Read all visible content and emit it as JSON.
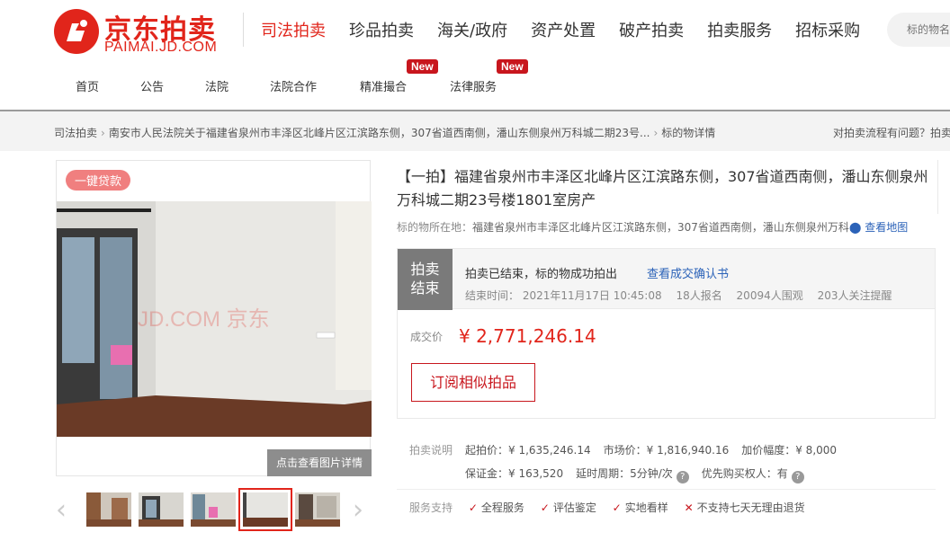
{
  "brand": {
    "cn": "京东拍卖",
    "en": "PAIMAI.JD.COM",
    "color": "#e1251b"
  },
  "main_nav": [
    "司法拍卖",
    "珍品拍卖",
    "海关/政府",
    "资产处置",
    "破产拍卖",
    "拍卖服务",
    "招标采购"
  ],
  "search": {
    "placeholder": "标的物名"
  },
  "sub_nav": {
    "items": [
      "首页",
      "公告",
      "法院",
      "法院合作",
      "精准撮合",
      "法律服务"
    ],
    "new_badge": "New"
  },
  "breadcrumb": {
    "items": [
      "司法拍卖",
      "南安市人民法院关于福建省泉州市丰泽区北峰片区江滨路东侧，307省道西南侧，潘山东侧泉州万科城二期23号...",
      "标的物详情"
    ],
    "help": "对拍卖流程有问题？拍卖"
  },
  "gallery": {
    "loan_tag": "一键贷款",
    "watermark": "JD.COM 京东",
    "view_detail": "点击查看图片详情"
  },
  "item": {
    "title": "【一拍】福建省泉州市丰泽区北峰片区江滨路东侧，307省道西南侧，潘山东侧泉州万科城二期23号楼1801室房产",
    "location_label": "标的物所在地：",
    "location": "福建省泉州市丰泽区北峰片区江滨路东侧，307省道西南侧，潘山东侧泉州万科...",
    "map_link": "查看地图"
  },
  "status": {
    "tag_line1": "拍卖",
    "tag_line2": "结束",
    "main": "拍卖已结束，标的物成功拍出",
    "confirm_link": "查看成交确认书",
    "end_time": "结束时间：  2021年11月17日 10:45:08",
    "signups": "18人报名",
    "views": "20094人围观",
    "watchers": "203人关注提醒"
  },
  "price": {
    "label": "成交价",
    "value": "¥ 2,771,246.14",
    "subscribe": "订阅相似拍品"
  },
  "auction_info": {
    "label": "拍卖说明",
    "start_price": "起拍价：¥ 1,635,246.14",
    "market_price": "市场价：¥ 1,816,940.16",
    "increment": "加价幅度：¥ 8,000",
    "deposit": "保证金：¥ 163,520",
    "delay": "延时周期：5分钟/次",
    "priority": "优先购买权人：有"
  },
  "service": {
    "label": "服务支持",
    "items": [
      "全程服务",
      "评估鉴定",
      "实地看样"
    ],
    "no_return": "不支持七天无理由退货"
  }
}
